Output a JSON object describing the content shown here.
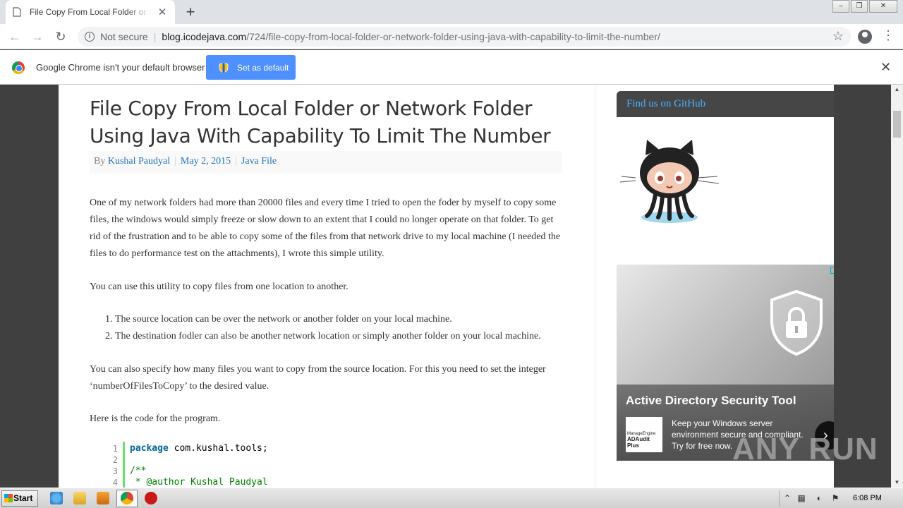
{
  "browser": {
    "tab_title": "File Copy From Local Folder or Network Folder Using Java With Capability To Limit The Number",
    "not_secure": "Not secure",
    "url_host": "blog.icodejava.com",
    "url_path": "/724/file-copy-from-local-folder-or-network-folder-using-java-with-capability-to-limit-the-number/"
  },
  "infobar": {
    "message": "Google Chrome isn't your default browser",
    "button": "Set as default"
  },
  "post": {
    "title": "File Copy From Local Folder or Network Folder Using Java With Capability To Limit The Number",
    "by": "By",
    "author": "Kushal Paudyal",
    "date": "May 2, 2015",
    "category": "Java File",
    "p1": "One of my network folders had more than 20000 files and every time I tried to open the foder by myself to copy some files, the windows would simply freeze or slow down to an extent that I could no longer operate on that folder. To get rid of the frustration and to be able to copy some of the files from that network drive to my local machine (I needed the files to do performance test on the attachments), I wrote this simple utility.",
    "p2": "You can use this utility to copy files from one location to another.",
    "list": [
      {
        "num": "1.",
        "text": "The source location can be over the network or another folder on your local machine."
      },
      {
        "num": "2.",
        "text": "The destination fodler can also be another network location or simply another folder on your local machine."
      }
    ],
    "p3": "You can also specify how many files you want to copy from the source location. For this you need to set the integer ‘numberOfFilesToCopy’ to the desired value.",
    "p4": "Here is the code for the program.",
    "code": {
      "line_numbers": [
        "1",
        "2",
        "3",
        "4"
      ],
      "l1_kw": "package",
      "l1_rest": " com.kushal.tools;",
      "l3": "/**",
      "l4": " * @author Kushal Paudyal"
    }
  },
  "sidebar": {
    "widget_title": "Find us on GitHub",
    "ad": {
      "title": "Active Directory Security Tool",
      "desc": "Keep your Windows server environment secure and compliant. Try for free now.",
      "logo_top": "ManageEngine",
      "logo_main": "ADAudit Plus"
    }
  },
  "taskbar": {
    "start": "Start",
    "clock": "6:08 PM"
  },
  "watermark": "ANY RUN",
  "colors": {
    "link": "#1e73be",
    "widget_title": "#47b3ff",
    "button": "#4d90fe"
  }
}
